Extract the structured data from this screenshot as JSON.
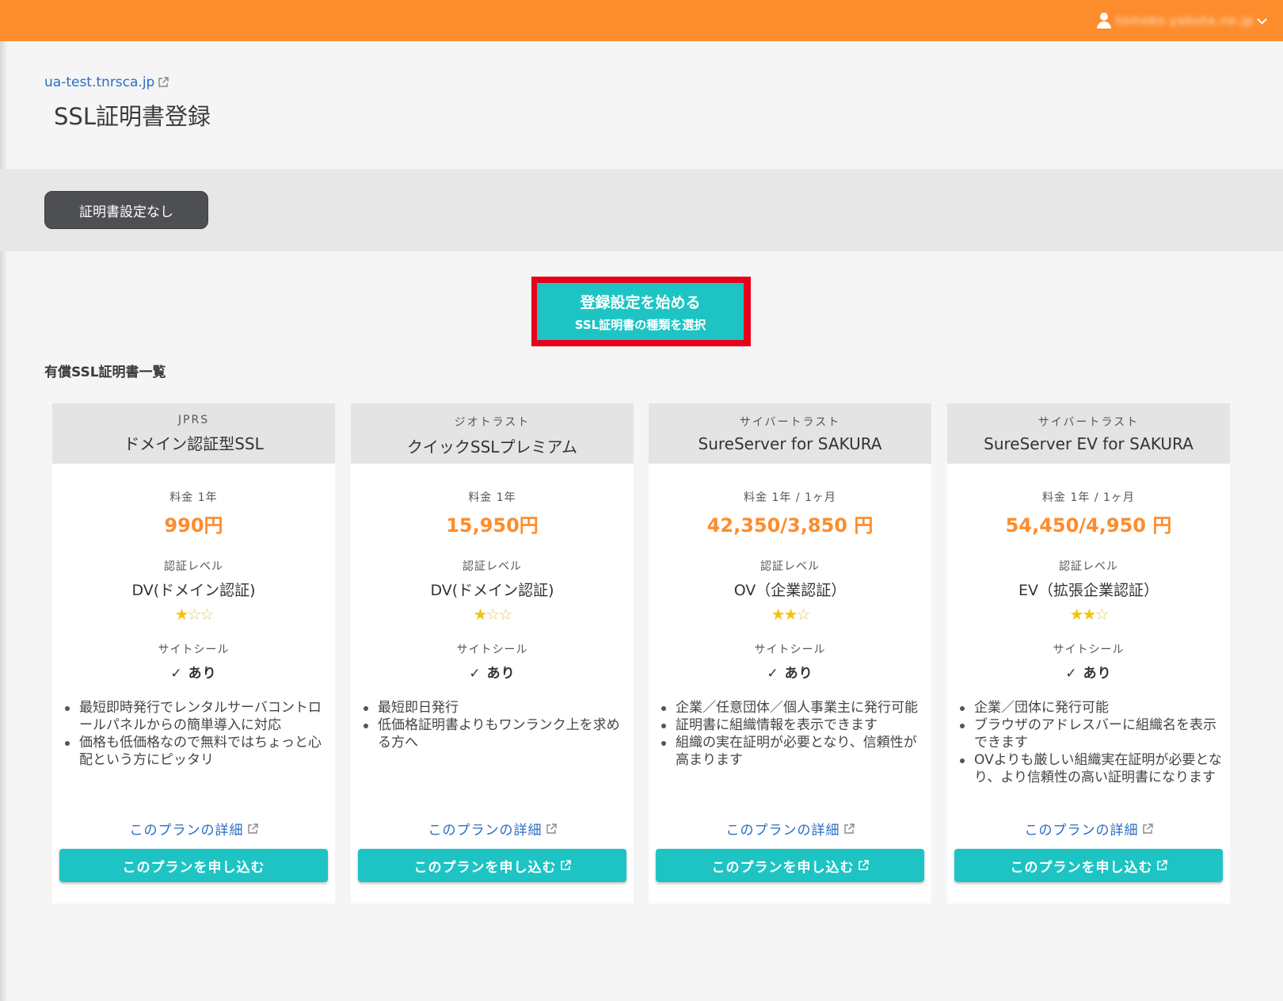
{
  "header": {
    "user_name": "tomoko.yabuta.ne.jp",
    "user_icon": "user-icon",
    "menu_icon": "chevron-down-icon"
  },
  "site": {
    "domain_link": "ua-test.tnrsca.jp",
    "page_title": "SSL証明書登録"
  },
  "actions": {
    "no_cert_label": "証明書設定なし",
    "start_line1": "登録設定を始める",
    "start_line2": "SSL証明書の種類を選択"
  },
  "section_title": "有償SSL証明書一覧",
  "labels": {
    "level_label": "認証レベル",
    "seal_label": "サイトシール",
    "detail_link": "このプランの詳細",
    "apply_button": "このプランを申し込む"
  },
  "colors": {
    "topbar": "#fd8c2c",
    "accent": "#1ec4c4",
    "price": "#fd8c2c",
    "highlight_border": "#e8001a"
  },
  "cards": [
    {
      "vendor": "JPRS",
      "name": "ドメイン認証型SSL",
      "price_label": "料金 1年",
      "price": "990円",
      "level": "DV(ドメイン認証)",
      "stars_filled": 1,
      "stars_total": 3,
      "seal": "✓ あり",
      "features": [
        "最短即時発行でレンタルサーバコントロールパネルからの簡単導入に対応",
        "価格も低価格なので無料ではちょっと心配という方にピッタリ"
      ]
    },
    {
      "vendor": "ジオトラスト",
      "name": "クイックSSLプレミアム",
      "price_label": "料金 1年",
      "price": "15,950円",
      "level": "DV(ドメイン認証)",
      "stars_filled": 1,
      "stars_total": 3,
      "seal": "✓ あり",
      "features": [
        "最短即日発行",
        "低価格証明書よりもワンランク上を求める方へ"
      ]
    },
    {
      "vendor": "サイバートラスト",
      "name": "SureServer for SAKURA",
      "price_label": "料金 1年 / 1ヶ月",
      "price": "42,350/3,850 円",
      "level": "OV（企業認証）",
      "stars_filled": 2,
      "stars_total": 3,
      "seal": "✓ あり",
      "features": [
        "企業／任意団体／個人事業主に発行可能",
        "証明書に組織情報を表示できます",
        "組織の実在証明が必要となり、信頼性が高まります"
      ]
    },
    {
      "vendor": "サイバートラスト",
      "name": "SureServer EV for SAKURA",
      "price_label": "料金 1年 / 1ヶ月",
      "price": "54,450/4,950 円",
      "level": "EV（拡張企業認証）",
      "stars_filled": 2,
      "stars_total": 3,
      "seal": "✓ あり",
      "features": [
        "企業／団体に発行可能",
        "ブラウザのアドレスバーに組織名を表示できます",
        "OVよりも厳しい組織実在証明が必要となり、より信頼性の高い証明書になります"
      ]
    }
  ]
}
